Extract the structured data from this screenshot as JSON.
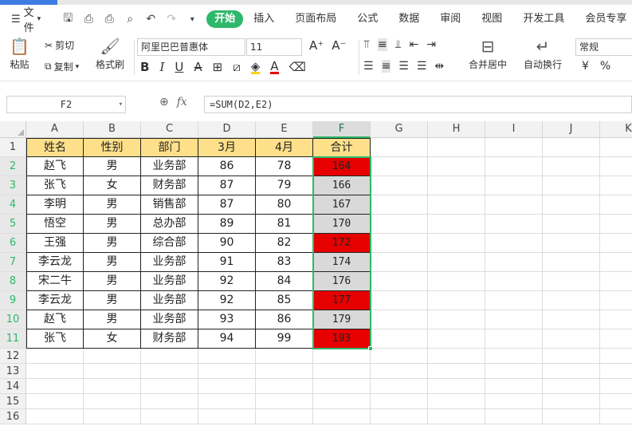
{
  "menubar": {
    "file_label": "文件",
    "tabs": [
      "开始",
      "插入",
      "页面布局",
      "公式",
      "数据",
      "审阅",
      "视图",
      "开发工具",
      "会员专享"
    ]
  },
  "ribbon": {
    "paste": "粘贴",
    "cut": "剪切",
    "copy": "复制",
    "format_painter": "格式刷",
    "font_name": "阿里巴巴普惠体",
    "font_size": "11",
    "merge_center": "合并居中",
    "wrap_text": "自动换行",
    "number_format": "常规",
    "currency_symbol": "¥",
    "percent_symbol": "%"
  },
  "formula_bar": {
    "name_box": "F2",
    "fx_label": "fx",
    "formula": "=SUM(D2,E2)"
  },
  "sheet": {
    "columns": [
      "A",
      "B",
      "C",
      "D",
      "E",
      "F",
      "G",
      "H",
      "I",
      "J",
      "K"
    ],
    "rows": [
      "1",
      "2",
      "3",
      "4",
      "5",
      "6",
      "7",
      "8",
      "9",
      "10",
      "11",
      "12",
      "13",
      "14",
      "15",
      "16"
    ],
    "selected_column": "F",
    "header": [
      "姓名",
      "性别",
      "部门",
      "3月",
      "4月",
      "合计"
    ],
    "data": [
      [
        "赵飞",
        "男",
        "业务部",
        "86",
        "78",
        "164"
      ],
      [
        "张飞",
        "女",
        "财务部",
        "87",
        "79",
        "166"
      ],
      [
        "李明",
        "男",
        "销售部",
        "87",
        "80",
        "167"
      ],
      [
        "悟空",
        "男",
        "总办部",
        "89",
        "81",
        "170"
      ],
      [
        "王强",
        "男",
        "综合部",
        "90",
        "82",
        "172"
      ],
      [
        "李云龙",
        "男",
        "业务部",
        "91",
        "83",
        "174"
      ],
      [
        "宋二牛",
        "男",
        "业务部",
        "92",
        "84",
        "176"
      ],
      [
        "李云龙",
        "男",
        "业务部",
        "92",
        "85",
        "177"
      ],
      [
        "赵飞",
        "男",
        "业务部",
        "93",
        "86",
        "179"
      ],
      [
        "张飞",
        "女",
        "财务部",
        "94",
        "99",
        "193"
      ]
    ],
    "highlight_rows": [
      0,
      4,
      7,
      9
    ]
  },
  "colors": {
    "header_fill": "#ffe08a",
    "highlight_fill": "#e60000",
    "selected_fill": "#d9d9d9",
    "accent": "#2eb86a"
  }
}
